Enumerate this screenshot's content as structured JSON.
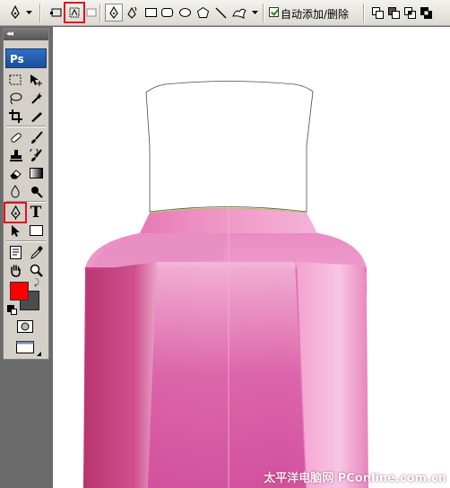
{
  "options_bar": {
    "auto_add_delete_label": "自动添加/删除",
    "auto_add_delete_checked": true
  },
  "toolbox": {
    "badge": "Ps",
    "grip": "◂◂",
    "text_tool_glyph": "T",
    "foreground_color": "#ff0000",
    "background_color": "#4c4c4c"
  },
  "canvas": {
    "watermark": "太平洋电脑网 PConline.com.cn"
  }
}
